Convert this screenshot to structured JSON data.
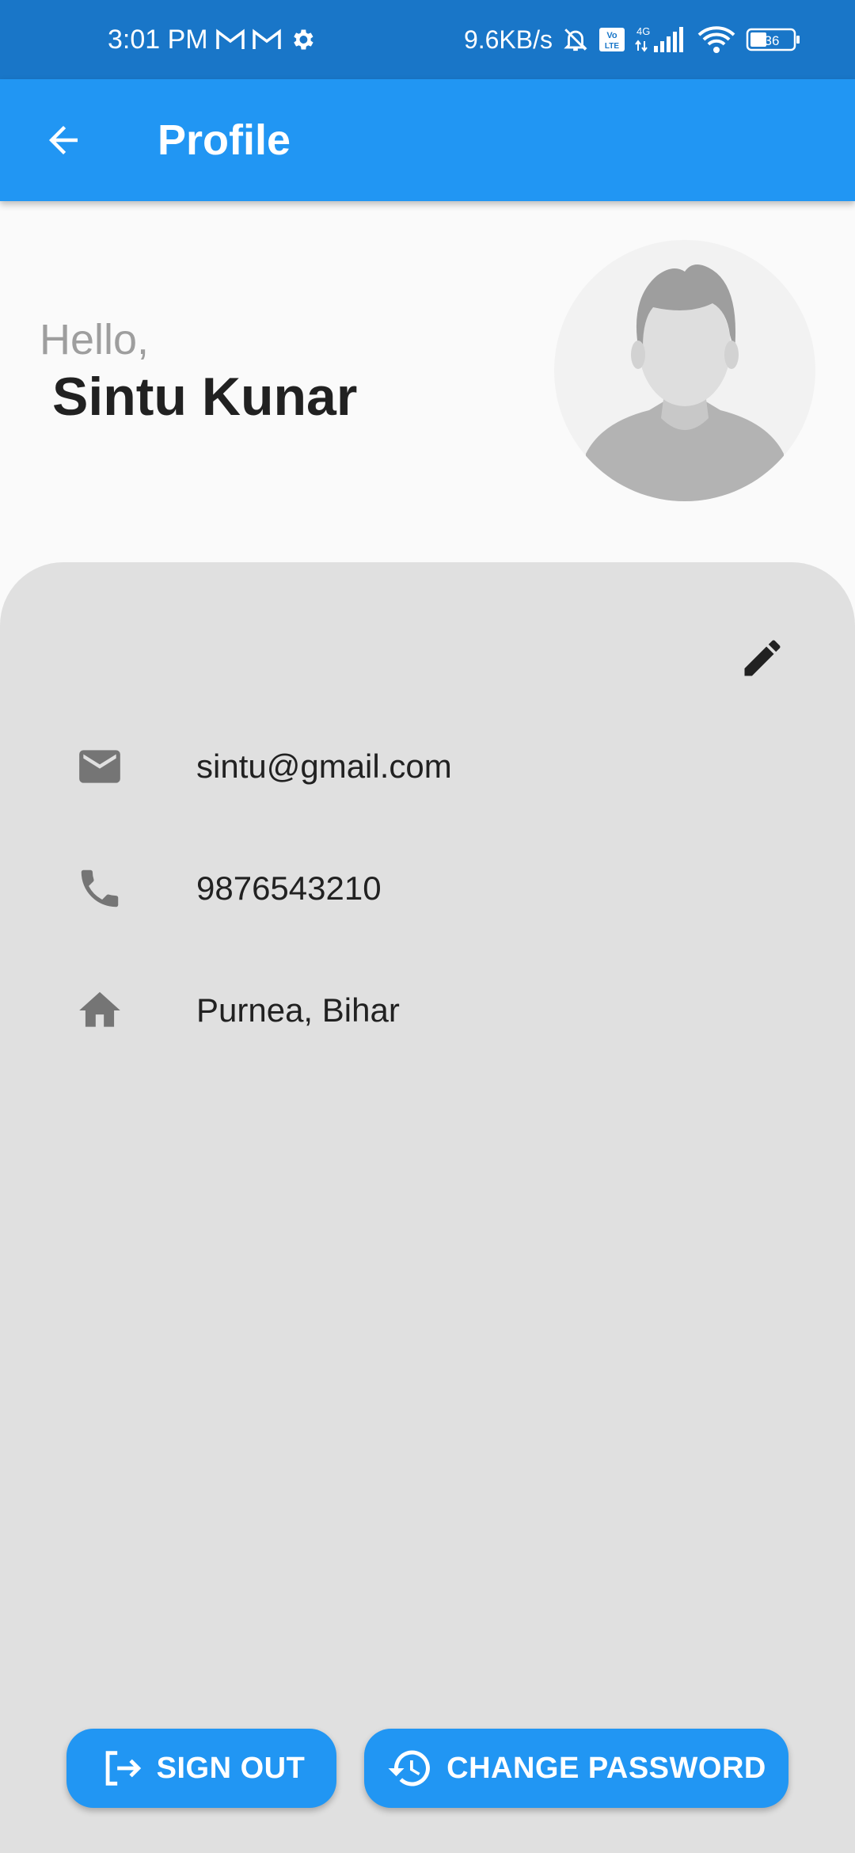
{
  "status_bar": {
    "time": "3:01 PM",
    "network_speed": "9.6KB/s",
    "network_type": "4G",
    "volte": "Vo LTE",
    "battery": "36",
    "icons": [
      "gmail-icon",
      "gmail-icon",
      "settings-icon",
      "mute-icon",
      "volte-icon",
      "signal-icon",
      "wifi-icon",
      "battery-icon"
    ]
  },
  "app_bar": {
    "title": "Profile",
    "back_icon": "arrow-back-icon"
  },
  "header": {
    "greeting": "Hello,",
    "name": "Sintu Kunar",
    "avatar_icon": "default-avatar"
  },
  "details": {
    "edit_icon": "pencil-icon",
    "items": [
      {
        "icon": "email-icon",
        "value": "sintu@gmail.com"
      },
      {
        "icon": "phone-icon",
        "value": "9876543210"
      },
      {
        "icon": "home-icon",
        "value": "Purnea, Bihar"
      }
    ]
  },
  "actions": {
    "sign_out": "SIGN OUT",
    "change_password": "CHANGE PASSWORD"
  },
  "colors": {
    "status_bar": "#1976c8",
    "primary": "#2196f3",
    "card": "#e0e0e0",
    "background": "#fafafa",
    "icon_grey": "#757575"
  }
}
